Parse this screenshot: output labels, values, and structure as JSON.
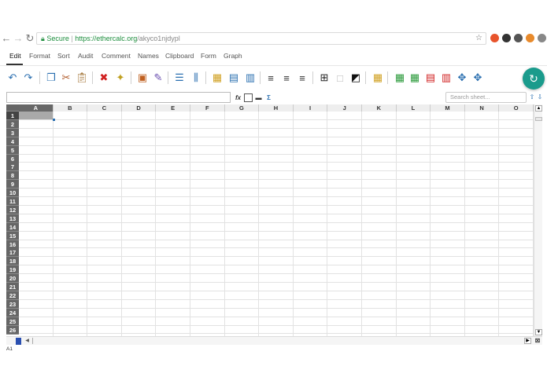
{
  "browser": {
    "back_icon": "arrow-left-icon",
    "forward_icon": "arrow-right-icon",
    "reload_icon": "reload-icon",
    "secure_label": "Secure",
    "url_scheme": "https://",
    "url_domain": "ethercalc.org",
    "url_path": "/akyco1njdypl",
    "extensions": [
      {
        "name": "adblock-icon",
        "color": "#e8542c"
      },
      {
        "name": "extension-icon",
        "color": "#333333"
      },
      {
        "name": "extension-icon",
        "color": "#555555"
      },
      {
        "name": "extension-icon",
        "color": "#e88a2c"
      },
      {
        "name": "extension-icon",
        "color": "#888888"
      }
    ]
  },
  "menu": {
    "items": [
      "Edit",
      "Format",
      "Sort",
      "Audit",
      "Comment",
      "Names",
      "Clipboard",
      "Form",
      "Graph"
    ],
    "active": "Edit"
  },
  "toolbar": {
    "icons": [
      "undo-icon",
      "redo-icon",
      "copy-icon",
      "cut-icon",
      "paste-icon",
      "delete-icon",
      "magic-wand-icon",
      "lock-icon",
      "edit-icon",
      "insert-row-icon",
      "insert-col-icon",
      "grid-icon",
      "merge-icon",
      "unmerge-icon",
      "align-left-icon",
      "align-center-icon",
      "align-right-icon",
      "borders-icon",
      "no-borders-icon",
      "color-icon",
      "table-icon",
      "add-row-icon",
      "add-col-icon",
      "delete-row-icon",
      "delete-col-icon",
      "pan-icon",
      "move-icon"
    ],
    "sync_icon": "sync-icon",
    "accent": "#1a9b8c"
  },
  "formula_bar": {
    "value": "",
    "icons": [
      "function-icon",
      "sheet-icon",
      "link-icon",
      "sum-icon"
    ]
  },
  "search": {
    "placeholder": "Search sheet..."
  },
  "sheet": {
    "columns": [
      "A",
      "B",
      "C",
      "D",
      "E",
      "F",
      "G",
      "H",
      "I",
      "J",
      "K",
      "L",
      "M",
      "N",
      "O"
    ],
    "rows": [
      "1",
      "2",
      "3",
      "4",
      "5",
      "6",
      "7",
      "8",
      "9",
      "10",
      "11",
      "12",
      "13",
      "14",
      "15",
      "16",
      "17",
      "18",
      "19",
      "20",
      "21",
      "22",
      "23",
      "24",
      "25",
      "26"
    ],
    "selected_cell": "A1"
  },
  "status": {
    "cell_ref": "A1"
  }
}
